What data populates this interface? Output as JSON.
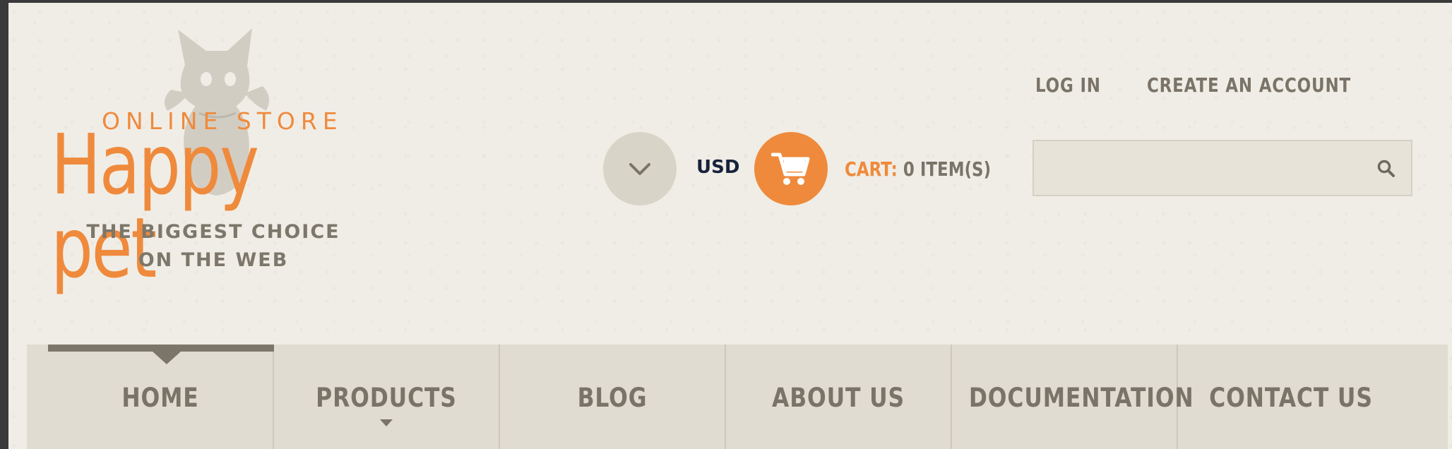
{
  "brand": {
    "kicker": "ONLINE STORE",
    "name": "Happy pet",
    "tagline_line1": "THE BIGGEST CHOICE",
    "tagline_line2": "ON THE WEB",
    "accent_color": "#ef8a3c"
  },
  "account": {
    "login": "LOG IN",
    "create_account": "CREATE AN ACCOUNT"
  },
  "currency": {
    "selected": "USD",
    "toggle_icon": "chevron-down-icon"
  },
  "cart": {
    "label": "CART:",
    "count_text": "0 ITEM(S)",
    "icon": "shopping-cart-icon"
  },
  "search": {
    "placeholder": "",
    "icon": "search-icon"
  },
  "nav": {
    "items": [
      {
        "label": "HOME",
        "active": true
      },
      {
        "label": "PRODUCTS",
        "has_dropdown": true
      },
      {
        "label": "BLOG"
      },
      {
        "label": "ABOUT US"
      },
      {
        "label": "DOCUMENTATION"
      },
      {
        "label": "CONTACT US"
      }
    ]
  }
}
